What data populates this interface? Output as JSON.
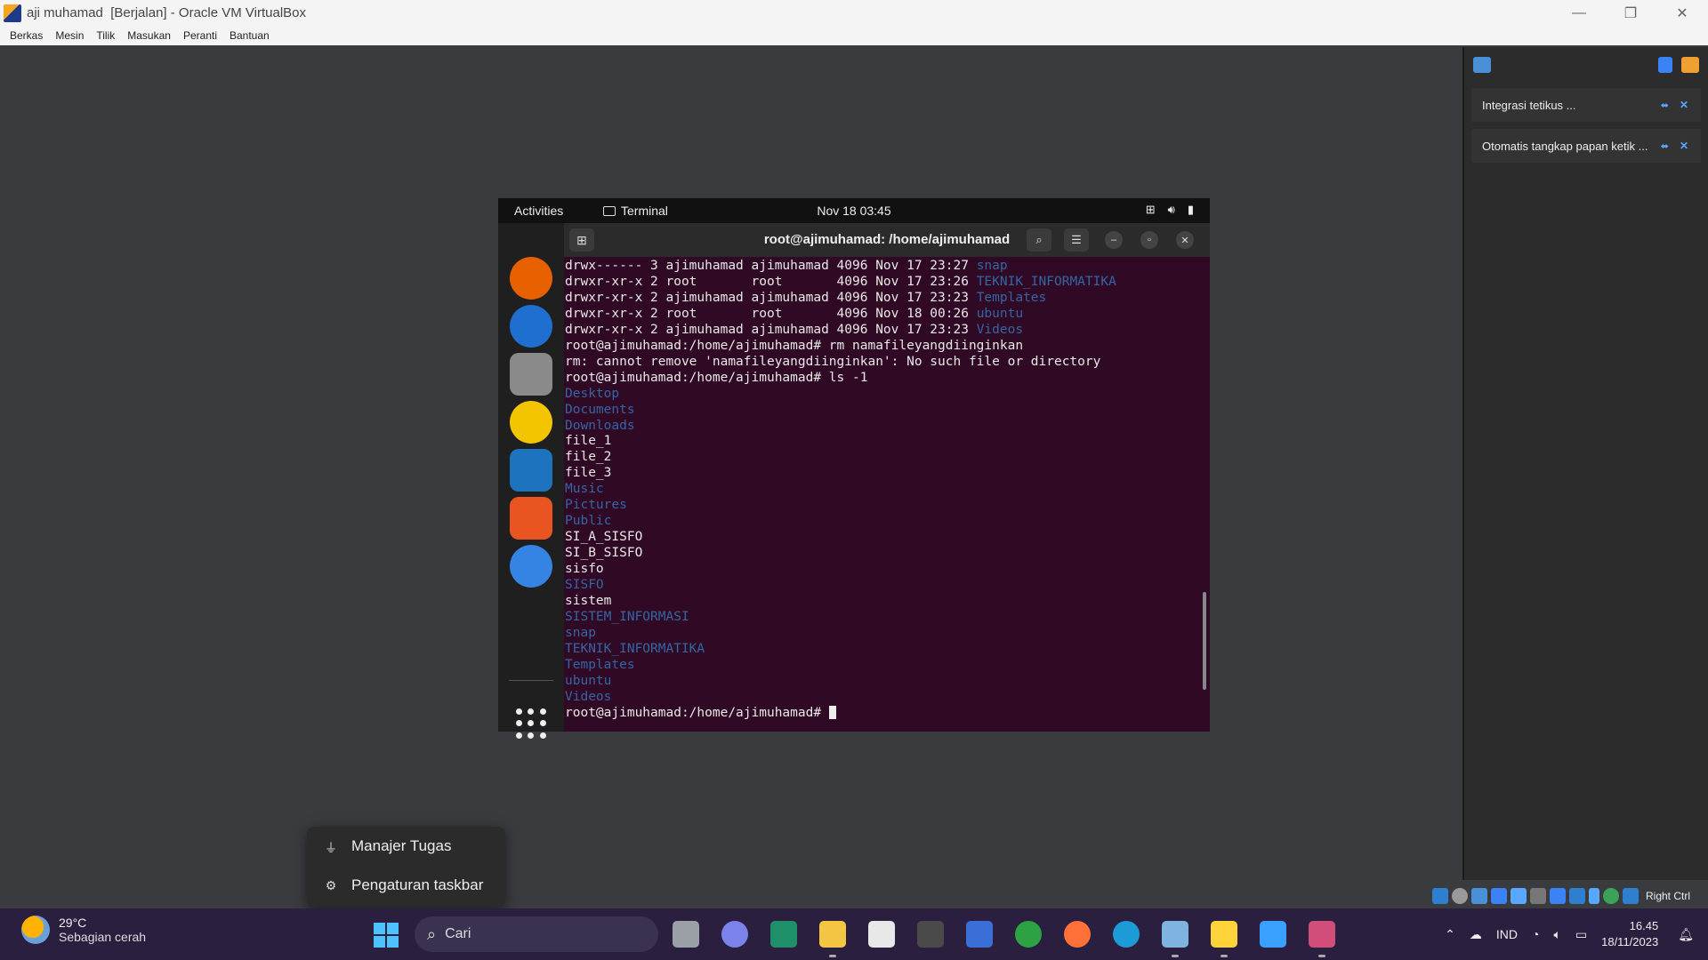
{
  "window": {
    "title": "aji muhamad  [Berjalan] - Oracle VM VirtualBox",
    "minimize_glyph": "—",
    "restore_glyph": "❐",
    "close_glyph": "✕"
  },
  "menubar": [
    "Berkas",
    "Mesin",
    "Tilik",
    "Masukan",
    "Peranti",
    "Bantuan"
  ],
  "notification_panel": {
    "items": [
      {
        "text": "Integrasi tetikus ..."
      },
      {
        "text": "Otomatis tangkap papan ketik ..."
      }
    ],
    "pin_glyph": "⬌",
    "close_glyph": "✕"
  },
  "guest": {
    "topbar": {
      "activities": "Activities",
      "app": "Terminal",
      "clock": "Nov 18  03:45"
    },
    "dock": [
      {
        "name": "firefox-icon",
        "color": "#e66000"
      },
      {
        "name": "thunderbird-icon",
        "color": "#1f6fd1"
      },
      {
        "name": "files-icon",
        "color": "#8a8a8a"
      },
      {
        "name": "rhythmbox-icon",
        "color": "#f2c500"
      },
      {
        "name": "writer-icon",
        "color": "#1e73be"
      },
      {
        "name": "software-icon",
        "color": "#e95420"
      },
      {
        "name": "help-icon",
        "color": "#3584e4"
      }
    ],
    "terminal": {
      "title": "root@ajimuhamad: /home/ajimuhamad",
      "lines": [
        {
          "text": "drwx------ 3 ajimuhamad ajimuhamad 4096 Nov 17 23:27 ",
          "dir": "snap"
        },
        {
          "text": "drwxr-xr-x 2 root       root       4096 Nov 17 23:26 ",
          "dir": "TEKNIK_INFORMATIKA"
        },
        {
          "text": "drwxr-xr-x 2 ajimuhamad ajimuhamad 4096 Nov 17 23:23 ",
          "dir": "Templates"
        },
        {
          "text": "drwxr-xr-x 2 root       root       4096 Nov 18 00:26 ",
          "dir": "ubuntu"
        },
        {
          "text": "drwxr-xr-x 2 ajimuhamad ajimuhamad 4096 Nov 17 23:23 ",
          "dir": "Videos"
        },
        {
          "text": "root@ajimuhamad:/home/ajimuhamad# rm namafileyangdiinginkan",
          "dir": ""
        },
        {
          "text": "rm: cannot remove 'namafileyangdiinginkan': No such file or directory",
          "dir": ""
        },
        {
          "text": "root@ajimuhamad:/home/ajimuhamad# ls -1",
          "dir": ""
        },
        {
          "text": "",
          "dir": "Desktop"
        },
        {
          "text": "",
          "dir": "Documents"
        },
        {
          "text": "",
          "dir": "Downloads"
        },
        {
          "text": "file_1",
          "dir": ""
        },
        {
          "text": "file_2",
          "dir": ""
        },
        {
          "text": "file_3",
          "dir": ""
        },
        {
          "text": "",
          "dir": "Music"
        },
        {
          "text": "",
          "dir": "Pictures"
        },
        {
          "text": "",
          "dir": "Public"
        },
        {
          "text": "SI_A_SISFO",
          "dir": ""
        },
        {
          "text": "SI_B_SISFO",
          "dir": ""
        },
        {
          "text": "sisfo",
          "dir": ""
        },
        {
          "text": "",
          "dir": "SISFO"
        },
        {
          "text": "sistem",
          "dir": ""
        },
        {
          "text": "",
          "dir": "SISTEM_INFORMASI"
        },
        {
          "text": "",
          "dir": "snap"
        },
        {
          "text": "",
          "dir": "TEKNIK_INFORMATIKA"
        },
        {
          "text": "",
          "dir": "Templates"
        },
        {
          "text": "",
          "dir": "ubuntu"
        },
        {
          "text": "",
          "dir": "Videos"
        }
      ],
      "prompt": "root@ajimuhamad:/home/ajimuhamad# "
    }
  },
  "context_menu": {
    "items": [
      "Manajer Tugas",
      "Pengaturan taskbar"
    ]
  },
  "vbox_status": {
    "host_key": "Right Ctrl"
  },
  "taskbar": {
    "weather_temp": "29°C",
    "weather_desc": "Sebagian cerah",
    "search_label": "Cari",
    "apps": [
      {
        "name": "task-view-icon",
        "color": "#9aa0a6"
      },
      {
        "name": "teams-icon",
        "color": "#7b83eb"
      },
      {
        "name": "ide-icon",
        "color": "#1f8f6a"
      },
      {
        "name": "file-explorer-icon",
        "color": "#f4c542"
      },
      {
        "name": "ms-store-icon",
        "color": "#e8e8e8"
      },
      {
        "name": "unity-icon",
        "color": "#4a4a4a"
      },
      {
        "name": "vs-icon",
        "color": "#3b6fd8"
      },
      {
        "name": "xbox-icon",
        "color": "#2ca243"
      },
      {
        "name": "firefox-icon",
        "color": "#ff7139"
      },
      {
        "name": "edge-icon",
        "color": "#1d9bd6"
      },
      {
        "name": "virtualbox-icon",
        "color": "#7fb3e0"
      },
      {
        "name": "python-icon",
        "color": "#ffd43b"
      },
      {
        "name": "photos-icon",
        "color": "#3aa0ff"
      },
      {
        "name": "snipping-tool-icon",
        "color": "#d14e7a"
      }
    ],
    "language": "IND",
    "time": "16.45",
    "date": "18/11/2023"
  }
}
